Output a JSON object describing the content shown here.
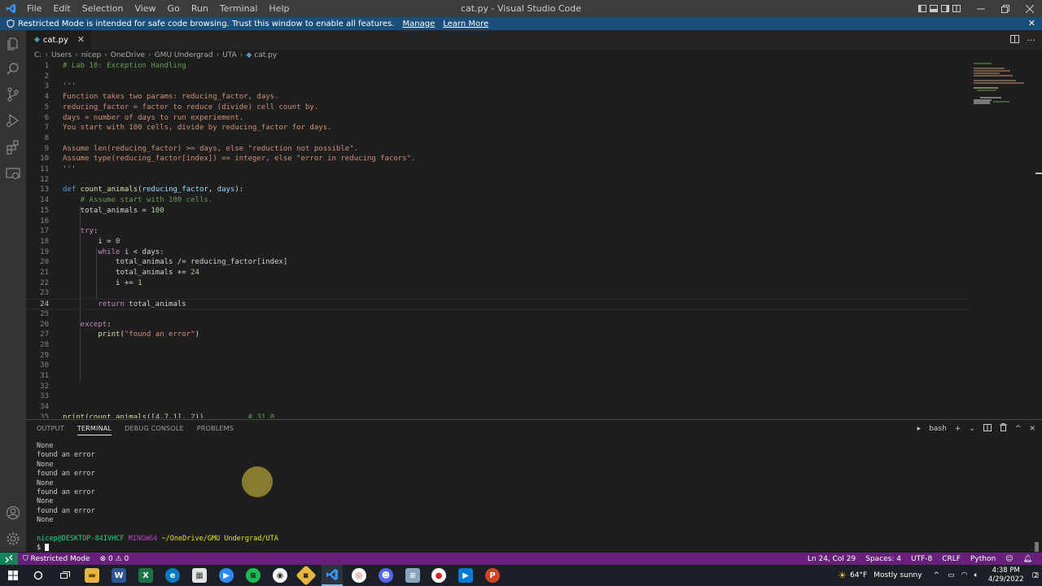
{
  "window": {
    "title": "cat.py - Visual Studio Code",
    "menu": [
      "File",
      "Edit",
      "Selection",
      "View",
      "Go",
      "Run",
      "Terminal",
      "Help"
    ]
  },
  "banner": {
    "message": "Restricted Mode is intended for safe code browsing. Trust this window to enable all features.",
    "manage": "Manage",
    "learn_more": "Learn More"
  },
  "tab": {
    "label": "cat.py"
  },
  "breadcrumb": [
    "C:",
    "Users",
    "nicep",
    "OneDrive",
    "GMU Undergrad",
    "UTA",
    "cat.py"
  ],
  "editor": {
    "line_numbers": [
      "1",
      "2",
      "3",
      "4",
      "5",
      "6",
      "7",
      "8",
      "9",
      "10",
      "11",
      "12",
      "13",
      "14",
      "15",
      "16",
      "17",
      "18",
      "19",
      "20",
      "21",
      "22",
      "23",
      "24",
      "25",
      "26",
      "27",
      "28",
      "29",
      "30",
      "31",
      "32",
      "33",
      "34",
      "35"
    ],
    "active_line": "24"
  },
  "panel": {
    "tabs": [
      "OUTPUT",
      "TERMINAL",
      "DEBUG CONSOLE",
      "PROBLEMS"
    ],
    "active_tab": "TERMINAL",
    "shell": "bash",
    "terminal_lines": [
      "None",
      "found an error",
      "None",
      "found an error",
      "None",
      "found an error",
      "None",
      "found an error",
      "None"
    ],
    "prompt_user": "nicep@DESKTOP-84IVHCF",
    "prompt_shell": "MINGW64",
    "prompt_path": "~/OneDrive/GMU Undergrad/UTA",
    "prompt_symbol": "$"
  },
  "statusbar": {
    "restricted": "Restricted Mode",
    "errors": "0",
    "warnings": "0",
    "position": "Ln 24, Col 29",
    "spaces": "Spaces: 4",
    "encoding": "UTF-8",
    "eol": "CRLF",
    "language": "Python"
  },
  "taskbar": {
    "weather_temp": "64°F",
    "weather_text": "Mostly sunny",
    "time": "4:38 PM",
    "date": "4/29/2022",
    "notifications": "2"
  },
  "colors": {
    "accent_status": "#68217a",
    "banner": "#1b4e7a",
    "remote": "#16825d"
  }
}
